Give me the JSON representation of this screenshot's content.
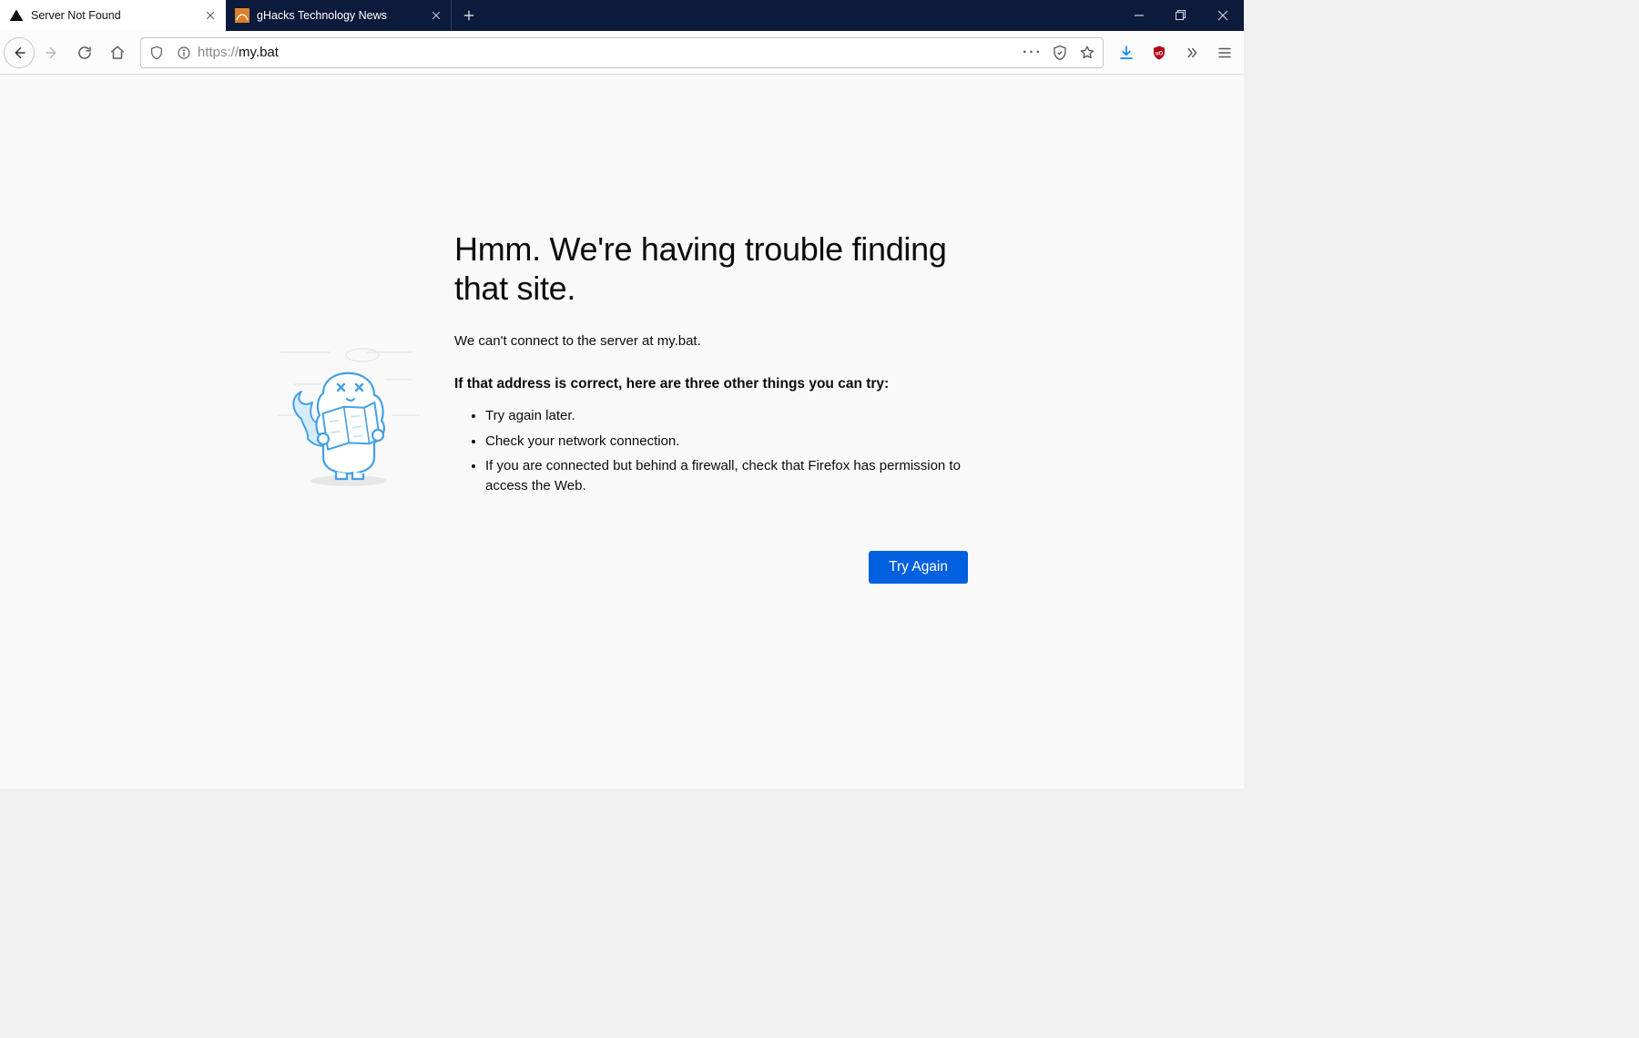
{
  "tabs": [
    {
      "title": "Server Not Found"
    },
    {
      "title": "gHacks Technology News"
    }
  ],
  "urlbar": {
    "protocol": "https://",
    "host": "my.bat"
  },
  "error": {
    "heading": "Hmm. We're having trouble finding that site.",
    "subtitle": "We can't connect to the server at my.bat.",
    "lead": "If that address is correct, here are three other things you can try:",
    "bullets": [
      "Try again later.",
      "Check your network connection.",
      "If you are connected but behind a firewall, check that Firefox has permission to access the Web."
    ],
    "button": "Try Again"
  }
}
